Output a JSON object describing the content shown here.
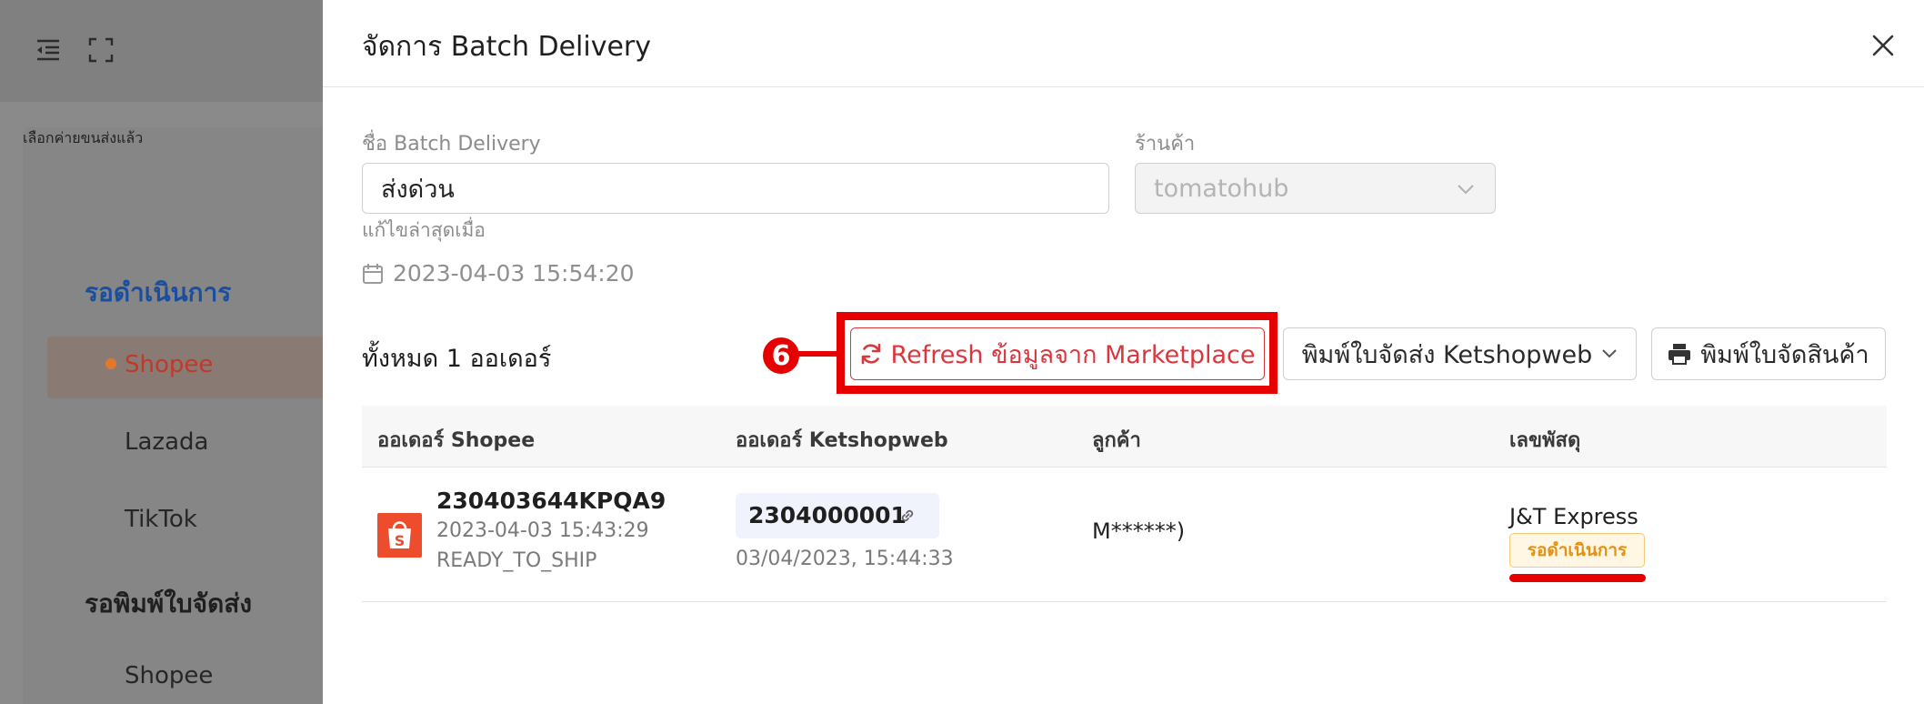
{
  "background": {
    "panel_heading": "เลือกค่ายขนส่งแล้ว",
    "sections": [
      {
        "title": "รอดำเนินการ",
        "color": "#1a4fa0",
        "items": [
          "Shopee",
          "Lazada",
          "TikTok"
        ]
      },
      {
        "title": "รอพิมพ์ใบจัดส่ง",
        "color": "#1f1f1f",
        "items": [
          "Shopee"
        ]
      }
    ],
    "active_dot_color": "#e07a2a"
  },
  "modal": {
    "title": "จัดการ Batch Delivery",
    "batch_name_label": "ชื่อ Batch Delivery",
    "batch_name_value": "ส่งด่วน",
    "store_label": "ร้านค้า",
    "store_value": "tomatohub",
    "last_edited_label": "แก้ไขล่าสุดเมื่อ",
    "last_edited_value": "2023-04-03 15:54:20",
    "total_orders": "ทั้งหมด 1 ออเดอร์",
    "buttons": {
      "refresh": "Refresh ข้อมูลจาก Marketplace",
      "print_shipping": "พิมพ์ใบจัดส่ง Ketshopweb",
      "print_packing": "พิมพ์ใบจัดสินค้า"
    },
    "callout_number": "6",
    "table": {
      "headers": [
        "ออเดอร์ Shopee",
        "ออเดอร์ Ketshopweb",
        "ลูกค้า",
        "เลขพัสดุ"
      ],
      "rows": [
        {
          "shopee_order": "230403644KPQA9",
          "shopee_date": "2023-04-03 15:43:29",
          "shopee_status": "READY_TO_SHIP",
          "ket_order": "2304000001",
          "ket_date": "03/04/2023, 15:44:33",
          "customer": "M******)",
          "carrier": "J&T Express",
          "status": "รอดำเนินการ"
        }
      ]
    }
  },
  "colors": {
    "accent_red": "#d9363e",
    "callout_red": "#e60000",
    "shopee_orange": "#ee4d2d",
    "status_amber": "#e49113"
  }
}
